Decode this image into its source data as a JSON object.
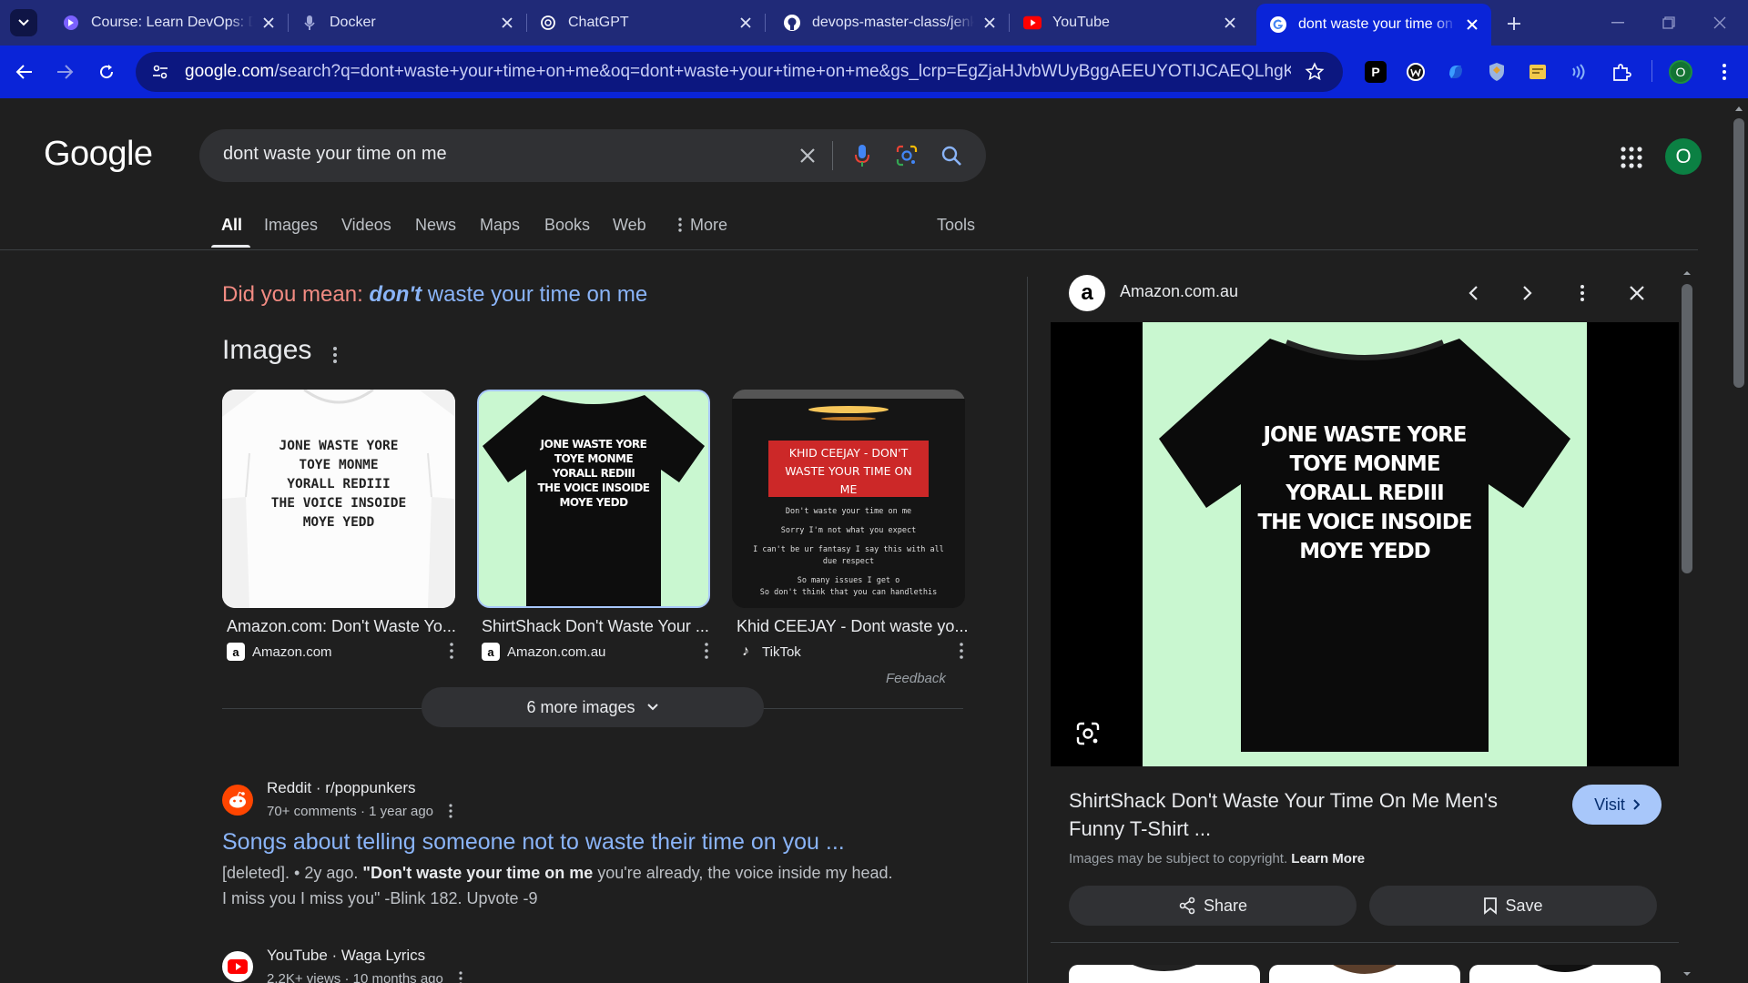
{
  "browser": {
    "tabs": [
      {
        "title": "Course: Learn DevOps: Do",
        "icon": "course-icon"
      },
      {
        "title": "Docker",
        "icon": "docker-icon"
      },
      {
        "title": "ChatGPT",
        "icon": "chatgpt-icon"
      },
      {
        "title": "devops-master-class/jenkin",
        "icon": "github-icon"
      },
      {
        "title": "YouTube",
        "icon": "youtube-icon"
      },
      {
        "title": "dont waste your time on m",
        "icon": "google-icon",
        "active": true
      }
    ],
    "url_host": "google.com",
    "url_rest": "/search?q=dont+waste+your+time+on+me&oq=dont+waste+your+time+on+me&gs_lcrp=EgZjaHJvbWUyBggAEEUYOTIJCAEQLhgKGIAEMgkIA...",
    "profile_initial": "O",
    "accent_color": "#0a24d8"
  },
  "google": {
    "logo_text": "Google",
    "query": "dont waste your time on me",
    "account_initial": "O",
    "tabs": [
      "All",
      "Images",
      "Videos",
      "News",
      "Maps",
      "Books",
      "Web",
      "More",
      "Tools"
    ],
    "did_you_mean_prefix": "Did you mean:",
    "did_you_mean_bold": "don't",
    "did_you_mean_rest": "waste your time on me",
    "images_heading": "Images",
    "shirt_text": [
      "JONE WASTE YORE",
      "TOYE MONME",
      "YORALL REDIII",
      "THE VOICE INSOIDE",
      "MOYE YEDD"
    ],
    "image_results": [
      {
        "title": "Amazon.com: Don't Waste Yo...",
        "source": "Amazon.com",
        "logo": "a"
      },
      {
        "title": "ShirtShack Don't Waste Your ...",
        "source": "Amazon.com.au",
        "logo": "a"
      },
      {
        "title": "Khid CEEJAY - Dont waste yo...",
        "source": "TikTok",
        "logo": "♪"
      }
    ],
    "tiktok_overlay": {
      "banner": [
        "KHID CEEJAY - DON'T",
        "WASTE YOUR TIME ON",
        "ME"
      ],
      "lines": [
        "Don't waste your time on me",
        "Sorry I'm not what you expect",
        "I can't be ur fantasy I say this with all",
        "due respect",
        "So many issues I get o",
        "So don't think that you can handlethis"
      ]
    },
    "feedback": "Feedback",
    "more_images": "6 more images",
    "results": [
      {
        "site": "Reddit · r/poppunkers",
        "meta": "70+ comments · 1 year ago",
        "title": "Songs about telling someone not to waste their time on you ...",
        "snippet_pre": "[deleted]. • 2y ago. ",
        "snippet_bold": "\"Don't waste your time on me",
        "snippet_post": " you're already, the voice inside my head. I miss you I miss you\" -Blink 182. Upvote -9"
      },
      {
        "site": "YouTube · Waga Lyrics",
        "meta": "2.2K+ views · 10 months ago"
      }
    ],
    "panel": {
      "source": "Amazon.com.au",
      "title": "ShirtShack Don't Waste Your Time On Me Men's Funny T-Shirt ...",
      "visit": "Visit",
      "copyright": "Images may be subject to copyright.",
      "learn_more": "Learn More",
      "share": "Share",
      "save": "Save"
    }
  }
}
